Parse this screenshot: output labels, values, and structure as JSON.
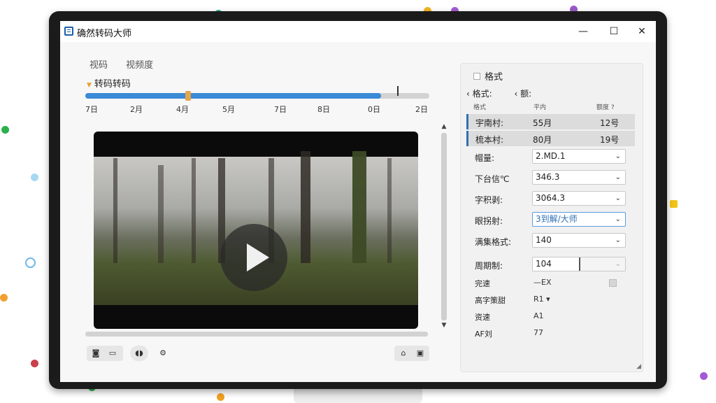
{
  "window": {
    "title": "确然转码大师",
    "controls": {
      "minimize": "—",
      "maximize": "☐",
      "close": "✕"
    }
  },
  "tabs": [
    {
      "label": "视码"
    },
    {
      "label": "视频度"
    }
  ],
  "section": {
    "label": "转码转码"
  },
  "timeline": {
    "progress": 0.86,
    "handle_position": 0.29,
    "ticks": [
      "7日",
      "2月",
      "4月",
      "5月",
      "7日",
      "8日",
      "0日",
      "2日"
    ]
  },
  "video": {
    "state": "paused"
  },
  "left_toolbar": {
    "icons": [
      "camera-icon",
      "subtitle-icon",
      "audio-icon",
      "settings-gear-icon"
    ]
  },
  "right_toolbar": {
    "icons": [
      "export-icon",
      "snapshot-icon"
    ]
  },
  "panel": {
    "title": "格式",
    "sub_left": "格式:",
    "sub_right": "额:",
    "grid_headers": {
      "c1": "格式",
      "c2": "平内",
      "c3": "额度 ?"
    },
    "grid_rows": [
      {
        "c1": "宇南村:",
        "c2": "55月",
        "c3": "12号"
      },
      {
        "c1": "梳本村:",
        "c2": "80月",
        "c3": "19号"
      }
    ],
    "fields": [
      {
        "label": "帽量:",
        "value": "2.MD.1",
        "active": false
      },
      {
        "label": "下台信℃",
        "value": "346.3",
        "active": false
      },
      {
        "label": "字积剥:",
        "value": "3064.3",
        "active": false
      },
      {
        "label": "眼拐射:",
        "value": "3到解/大师",
        "active": true
      },
      {
        "label": "满集格式:",
        "value": "140",
        "active": false
      },
      {
        "label": "周期制:",
        "value": "104",
        "active": false,
        "split": true
      }
    ],
    "props": [
      {
        "label": "完速",
        "value": "—EX"
      },
      {
        "label": "高字策甜",
        "value": "R1 ▾"
      },
      {
        "label": "资速",
        "value": "A1"
      },
      {
        "label": "AF刘",
        "value": "77"
      }
    ]
  }
}
